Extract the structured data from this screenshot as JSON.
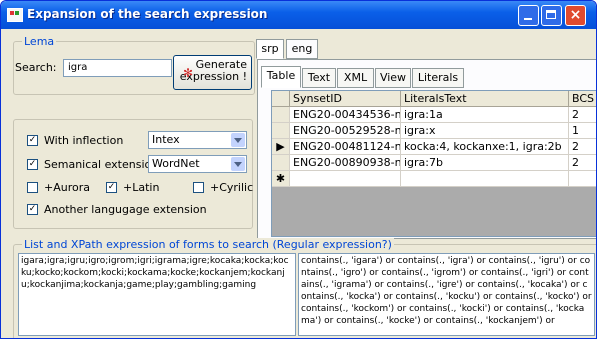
{
  "window": {
    "title": "Expansion of the search expression",
    "close_glyph": "×"
  },
  "lema": {
    "group_label": "Lema",
    "search_label": "Search:",
    "search_value": "igra",
    "generate_label_line1": "Generate",
    "generate_label_line2": "expression !",
    "generate_icon": "sparkle-icon",
    "generate_glyph": "✻"
  },
  "options": {
    "with_inflection": {
      "label": "With inflection",
      "checked": true,
      "select": "Intex"
    },
    "semantic_extension": {
      "label": "Semanical extension",
      "checked": true,
      "select": "WordNet"
    },
    "aurora": {
      "label": "+Aurora",
      "checked": false
    },
    "latin": {
      "label": "+Latin",
      "checked": true
    },
    "cyrilic": {
      "label": "+Cyrilic",
      "checked": false
    },
    "another_language": {
      "label": "Another langugage extension",
      "checked": true
    },
    "check_glyph": "✓"
  },
  "language_tabs": [
    "srp",
    "eng"
  ],
  "sub_tabs": [
    "Table",
    "Text",
    "XML",
    "View",
    "Literals"
  ],
  "grid": {
    "headers": [
      "SynsetID",
      "LiteralsText",
      "BCS"
    ],
    "rows": [
      {
        "marker": "",
        "synset": "ENG20-00434536-n",
        "literals": "igra:1a",
        "bcs": "2"
      },
      {
        "marker": "",
        "synset": "ENG20-00529528-n",
        "literals": "igra:x",
        "bcs": "1"
      },
      {
        "marker": "▶",
        "synset": "ENG20-00481124-n",
        "literals": "kocka:4, kockanxe:1, igra:2b",
        "bcs": "2"
      },
      {
        "marker": "",
        "synset": "ENG20-00890938-n",
        "literals": "igra:7b",
        "bcs": "2"
      },
      {
        "marker": "✱",
        "synset": "",
        "literals": "",
        "bcs": ""
      }
    ]
  },
  "xpath": {
    "group_label": "List and XPath expression of forms to search  (Regular expression?)",
    "forms_text": "igara;igra;igru;igro;igrom;igri;igrama;igre;kocaka;kocka;kocku;kocko;kockom;kocki;kockama;kocke;kockanjem;kockanju;kockanjima;kockanja;game;play;gambling;gaming",
    "xpath_text": "contains(., 'igara') or contains(., 'igra') or contains(., 'igru') or contains(., 'igro') or contains(., 'igrom') or contains(., 'igri') or contains(., 'igrama') or contains(., 'igre') or contains(., 'kocaka') or contains(., 'kocka') or contains(., 'kocku') or contains(., 'kocko') or contains(., 'kockom') or contains(., 'kocki') or contains(., 'kockama') or contains(., 'kocke') or contains(., 'kockanjem') or"
  }
}
